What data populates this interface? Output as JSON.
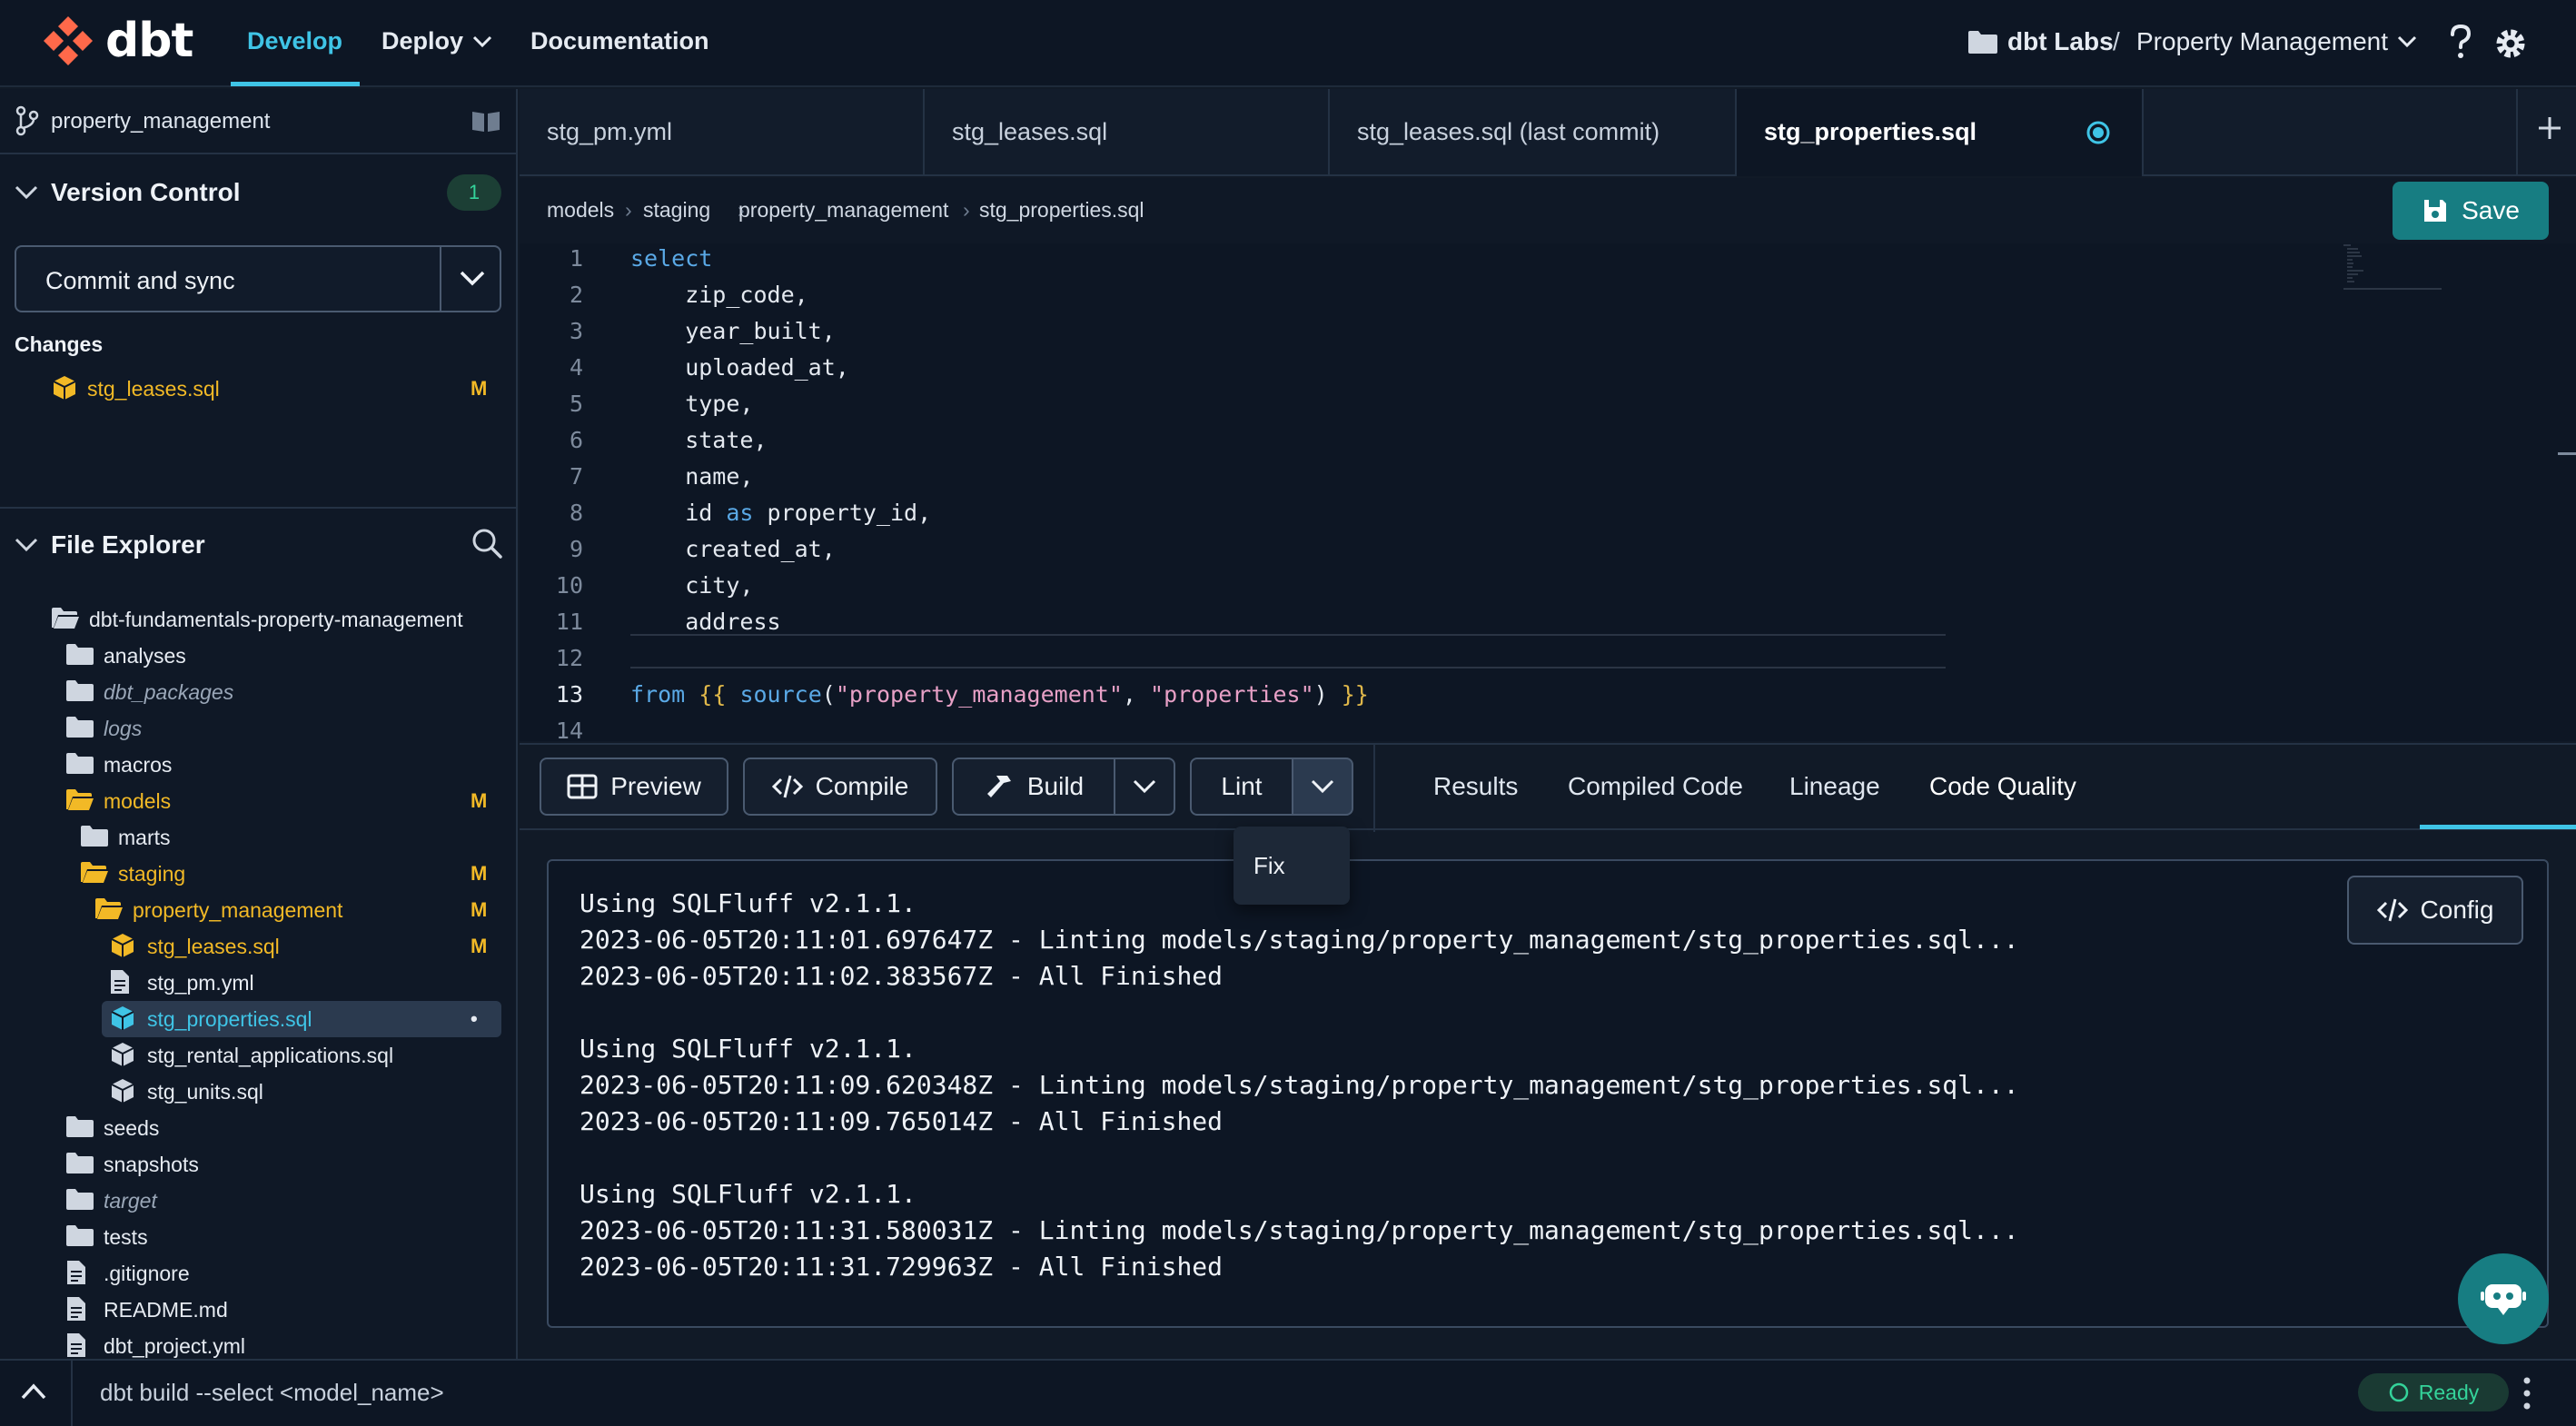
{
  "nav": {
    "logo_text": "dbt",
    "develop": "Develop",
    "deploy": "Deploy",
    "documentation": "Documentation",
    "account": "dbt Labs",
    "separator": "/",
    "project": "Property Management"
  },
  "sidebar": {
    "branch": "property_management",
    "version_control": {
      "title": "Version Control",
      "badge": "1",
      "commit_button": "Commit and sync",
      "changes_label": "Changes",
      "changes": [
        {
          "name": "stg_leases.sql",
          "flag": "M"
        }
      ]
    },
    "file_explorer": {
      "title": "File Explorer",
      "items": [
        {
          "name": "dbt-fundamentals-property-management",
          "type": "folder-open"
        },
        {
          "name": "analyses",
          "type": "folder"
        },
        {
          "name": "dbt_packages",
          "type": "folder"
        },
        {
          "name": "logs",
          "type": "folder"
        },
        {
          "name": "macros",
          "type": "folder"
        },
        {
          "name": "models",
          "type": "folder-open",
          "flag": "M"
        },
        {
          "name": "marts",
          "type": "folder"
        },
        {
          "name": "staging",
          "type": "folder-open",
          "flag": "M"
        },
        {
          "name": "property_management",
          "type": "folder-open",
          "flag": "M"
        },
        {
          "name": "stg_leases.sql",
          "type": "model",
          "flag": "M"
        },
        {
          "name": "stg_pm.yml",
          "type": "file"
        },
        {
          "name": "stg_properties.sql",
          "type": "model",
          "flag": "•"
        },
        {
          "name": "stg_rental_applications.sql",
          "type": "model"
        },
        {
          "name": "stg_units.sql",
          "type": "model"
        },
        {
          "name": "seeds",
          "type": "folder"
        },
        {
          "name": "snapshots",
          "type": "folder"
        },
        {
          "name": "target",
          "type": "folder"
        },
        {
          "name": "tests",
          "type": "folder"
        },
        {
          "name": ".gitignore",
          "type": "file"
        },
        {
          "name": "README.md",
          "type": "file"
        },
        {
          "name": "dbt_project.yml",
          "type": "file"
        }
      ]
    }
  },
  "editor": {
    "tabs": [
      {
        "label": "stg_pm.yml"
      },
      {
        "label": "stg_leases.sql"
      },
      {
        "label": "stg_leases.sql (last commit)"
      },
      {
        "label": "stg_properties.sql",
        "active": true
      }
    ],
    "breadcrumb": [
      "models",
      "staging",
      "property_management",
      "stg_properties.sql"
    ],
    "save_label": "Save",
    "lines": [
      "select",
      "    zip_code,",
      "    year_built,",
      "    uploaded_at,",
      "    type,",
      "    state,",
      "    name,",
      "    id as property_id,",
      "    created_at,",
      "    city,",
      "    address",
      "",
      "from {{ source(\"property_management\", \"properties\") }}",
      ""
    ],
    "line_numbers": [
      "1",
      "2",
      "3",
      "4",
      "5",
      "6",
      "7",
      "8",
      "9",
      "10",
      "11",
      "12",
      "13",
      "14"
    ],
    "current_line": "13"
  },
  "actions": {
    "preview": "Preview",
    "compile": "Compile",
    "build": "Build",
    "lint": "Lint",
    "lint_menu": [
      "Fix"
    ]
  },
  "result_tabs": {
    "results": "Results",
    "compiled": "Compiled Code",
    "lineage": "Lineage",
    "code_quality": "Code Quality"
  },
  "console": {
    "config_label": "Config",
    "lines": [
      "Using SQLFluff v2.1.1.",
      "2023-06-05T20:11:01.697647Z - Linting models/staging/property_management/stg_properties.sql...",
      "2023-06-05T20:11:02.383567Z - All Finished",
      "",
      "Using SQLFluff v2.1.1.",
      "2023-06-05T20:11:09.620348Z - Linting models/staging/property_management/stg_properties.sql...",
      "2023-06-05T20:11:09.765014Z - All Finished",
      "",
      "Using SQLFluff v2.1.1.",
      "2023-06-05T20:11:31.580031Z - Linting models/staging/property_management/stg_properties.sql...",
      "2023-06-05T20:11:31.729963Z - All Finished"
    ]
  },
  "status": {
    "command_placeholder": "dbt build --select <model_name>",
    "ready": "Ready"
  },
  "colors": {
    "accent": "#3fc4e6",
    "modified": "#f2b926",
    "save": "#177d82",
    "ready": "#34d39a"
  }
}
